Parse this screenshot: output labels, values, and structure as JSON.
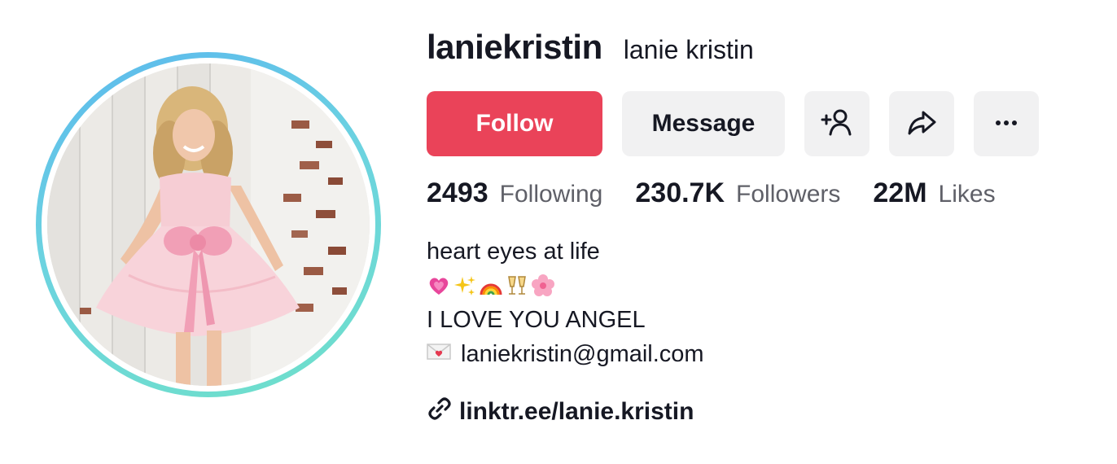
{
  "profile": {
    "username": "laniekristin",
    "nickname": "lanie kristin"
  },
  "actions": {
    "follow_label": "Follow",
    "message_label": "Message",
    "icons": [
      "add-friend-icon",
      "share-icon",
      "more-icon"
    ]
  },
  "stats": [
    {
      "value": "2493",
      "label": "Following"
    },
    {
      "value": "230.7K",
      "label": "Followers"
    },
    {
      "value": "22M",
      "label": "Likes"
    }
  ],
  "bio": {
    "line1": "heart eyes at life",
    "emojis": [
      "growing-heart-icon",
      "sparkles-icon",
      "rainbow-icon",
      "clinking-glasses-icon",
      "cherry-blossom-icon"
    ],
    "line3": "I LOVE YOU ANGEL",
    "email": "laniekristin@gmail.com",
    "email_icon": "love-letter-icon"
  },
  "link": {
    "text": "linktr.ee/lanie.kristin",
    "icon": "link-icon"
  },
  "colors": {
    "follow": "#ea4359",
    "button_bg": "#f1f1f2",
    "text": "#161823",
    "muted": "#5f6068",
    "ring_start": "#5bb8ee",
    "ring_end": "#6fe0c9"
  }
}
